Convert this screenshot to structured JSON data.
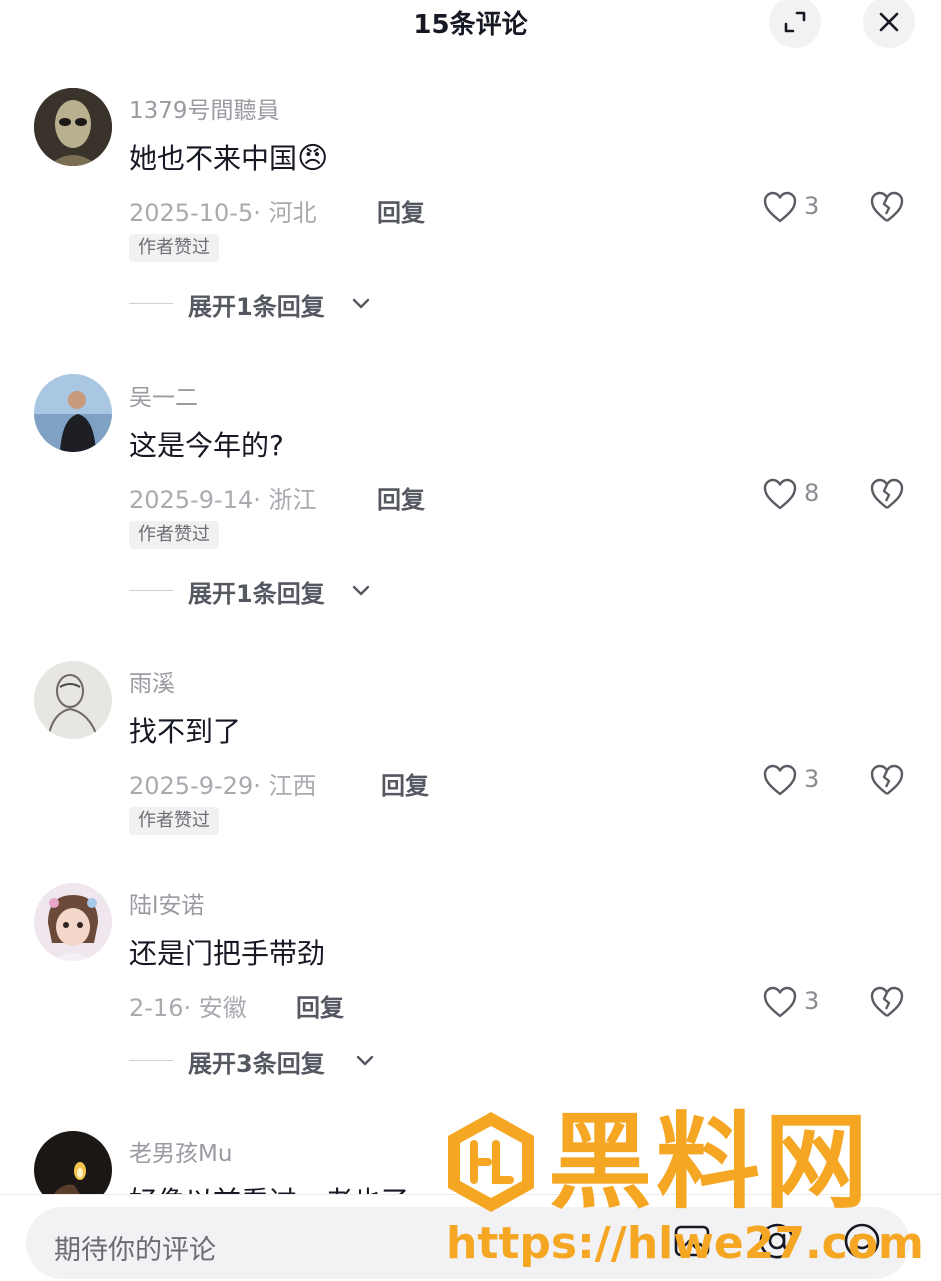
{
  "header": {
    "title": "15条评论"
  },
  "comments": [
    {
      "username": "1379号間聽員",
      "text": "她也不来中国",
      "emoji": "😠",
      "date_location": "2025-10-5· 河北",
      "reply_label": "回复",
      "likes": "3",
      "badge": "作者赞过",
      "expand": "展开1条回复"
    },
    {
      "username": "吴一二",
      "text": "这是今年的?",
      "date_location": "2025-9-14· 浙江",
      "reply_label": "回复",
      "likes": "8",
      "badge": "作者赞过",
      "expand": "展开1条回复"
    },
    {
      "username": "雨溪",
      "text": "找不到了",
      "date_location": "2025-9-29· 江西",
      "reply_label": "回复",
      "likes": "3",
      "badge": "作者赞过"
    },
    {
      "username": "陆l安诺",
      "text": "还是门把手带劲",
      "date_location": "2-16· 安徽",
      "reply_label": "回复",
      "likes": "3",
      "expand": "展开3条回复"
    },
    {
      "username": "老男孩Mu",
      "text": "好像以前看过，老也了"
    }
  ],
  "input": {
    "placeholder": "期待你的评论"
  },
  "watermark": {
    "brand": "黑料网",
    "url": "https://hlwe27.com"
  },
  "icons": [
    "expand-icon",
    "close-icon",
    "heart-icon",
    "broken-heart-icon",
    "chevron-down-icon",
    "image-icon",
    "at-icon",
    "emoji-icon"
  ]
}
